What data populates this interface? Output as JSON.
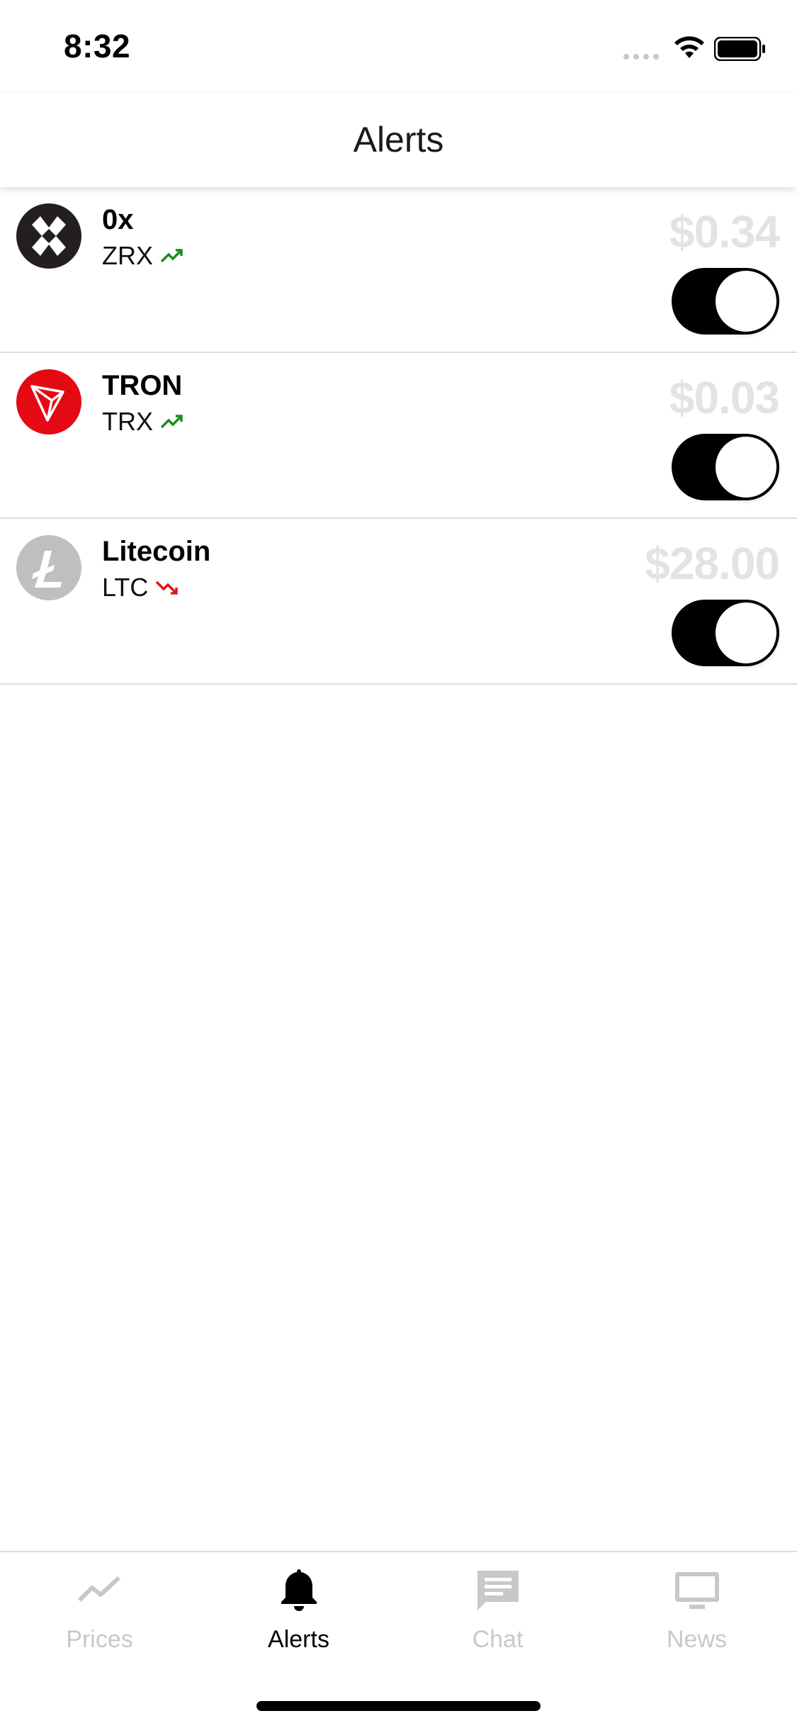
{
  "status_bar": {
    "time": "8:32"
  },
  "nav": {
    "title": "Alerts"
  },
  "alerts": [
    {
      "name": "0x",
      "symbol": "ZRX",
      "trend": "up",
      "price": "$0.34",
      "enabled": true,
      "logo": "zrx-logo-icon"
    },
    {
      "name": "TRON",
      "symbol": "TRX",
      "trend": "up",
      "price": "$0.03",
      "enabled": true,
      "logo": "tron-logo-icon"
    },
    {
      "name": "Litecoin",
      "symbol": "LTC",
      "trend": "down",
      "price": "$28.00",
      "enabled": true,
      "logo": "litecoin-logo-icon"
    }
  ],
  "tabs": [
    {
      "label": "Prices",
      "icon": "trend-line-icon",
      "active": false
    },
    {
      "label": "Alerts",
      "icon": "bell-icon",
      "active": true
    },
    {
      "label": "Chat",
      "icon": "chat-bubble-icon",
      "active": false
    },
    {
      "label": "News",
      "icon": "monitor-icon",
      "active": false
    }
  ],
  "colors": {
    "trend_up": "#1a8f1a",
    "trend_down": "#e0131a",
    "tron_red": "#e50914",
    "zrx_dark": "#231f20",
    "litecoin_grey": "#bfbfbf",
    "inactive_tab": "#c8c8c8",
    "price_grey": "#e3e3e3"
  }
}
